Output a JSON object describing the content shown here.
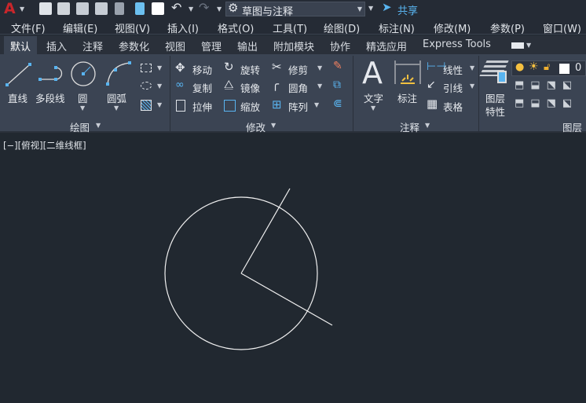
{
  "quick_access": {
    "workspace": "草图与注释",
    "share": "共享",
    "icons": [
      "autocad-logo-icon",
      "new-icon",
      "open-icon",
      "save-icon",
      "save-as-icon",
      "open-from-web-icon",
      "save-to-web-icon",
      "plot-icon",
      "undo-icon",
      "redo-icon",
      "gear-icon",
      "share-icon"
    ]
  },
  "menu": [
    "文件(F)",
    "编辑(E)",
    "视图(V)",
    "插入(I)",
    "格式(O)",
    "工具(T)",
    "绘图(D)",
    "标注(N)",
    "修改(M)",
    "参数(P)",
    "窗口(W)"
  ],
  "tabs": [
    "默认",
    "插入",
    "注释",
    "参数化",
    "视图",
    "管理",
    "输出",
    "附加模块",
    "协作",
    "精选应用",
    "Express Tools"
  ],
  "active_tab": "默认",
  "ribbon": {
    "draw": {
      "title": "绘图",
      "line": "直线",
      "polyline": "多段线",
      "circle": "圆",
      "arc": "圆弧"
    },
    "modify": {
      "title": "修改",
      "move": "移动",
      "rotate": "旋转",
      "trim": "修剪",
      "copy": "复制",
      "mirror": "镜像",
      "fillet": "圆角",
      "stretch": "拉伸",
      "scale": "缩放",
      "array": "阵列"
    },
    "annotation": {
      "title": "注释",
      "text": "文字",
      "dimension": "标注",
      "linear": "线性",
      "leader": "引线",
      "table": "表格"
    },
    "layers": {
      "title": "图层",
      "properties_line1": "图层",
      "properties_line2": "特性",
      "current_layer": "0"
    }
  },
  "viewport_label": "[−][俯视][二维线框]",
  "colors": {
    "canvas": "#212830",
    "ribbon": "#3b4453",
    "accent": "#59b4f0",
    "geometry": "#ffffff"
  }
}
